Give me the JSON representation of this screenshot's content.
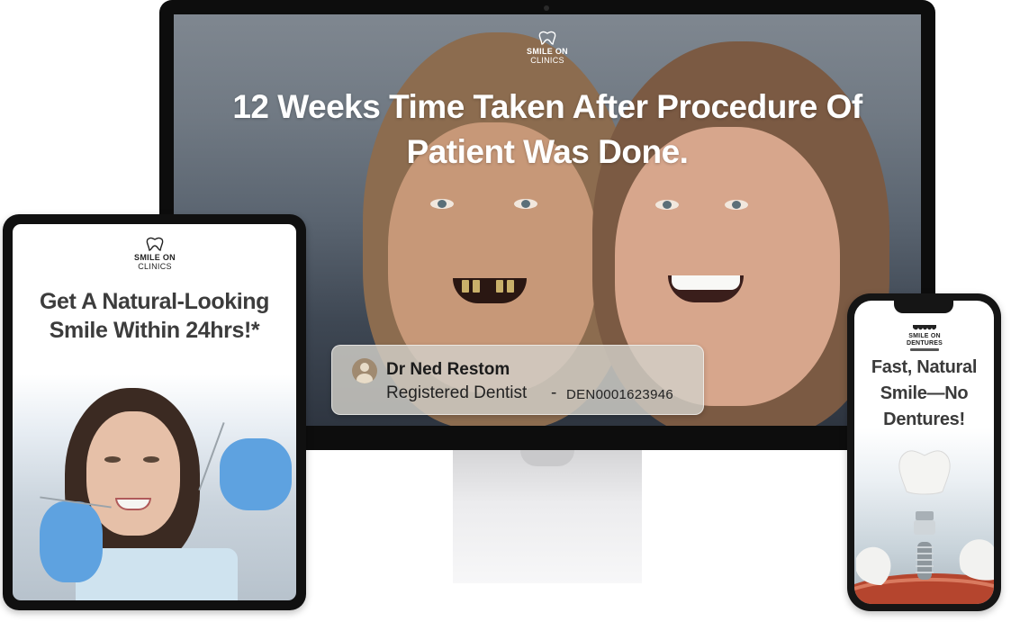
{
  "monitor": {
    "brand": {
      "line1": "SMILE ON",
      "line2": "CLINICS"
    },
    "headline": "12 Weeks Time Taken After Procedure Of Patient Was Done.",
    "doctor_card": {
      "name": "Dr Ned Restom",
      "role": "Registered Dentist",
      "separator": "-",
      "registration": "DEN0001623946"
    }
  },
  "tablet": {
    "brand": {
      "line1": "SMILE ON",
      "line2": "CLINICS"
    },
    "headline": "Get A Natural-Looking Smile Within 24hrs!*"
  },
  "phone": {
    "brand": {
      "line1": "SMILE ON",
      "line2": "DENTURES"
    },
    "headline": "Fast, Natural Smile—No Dentures!"
  }
}
